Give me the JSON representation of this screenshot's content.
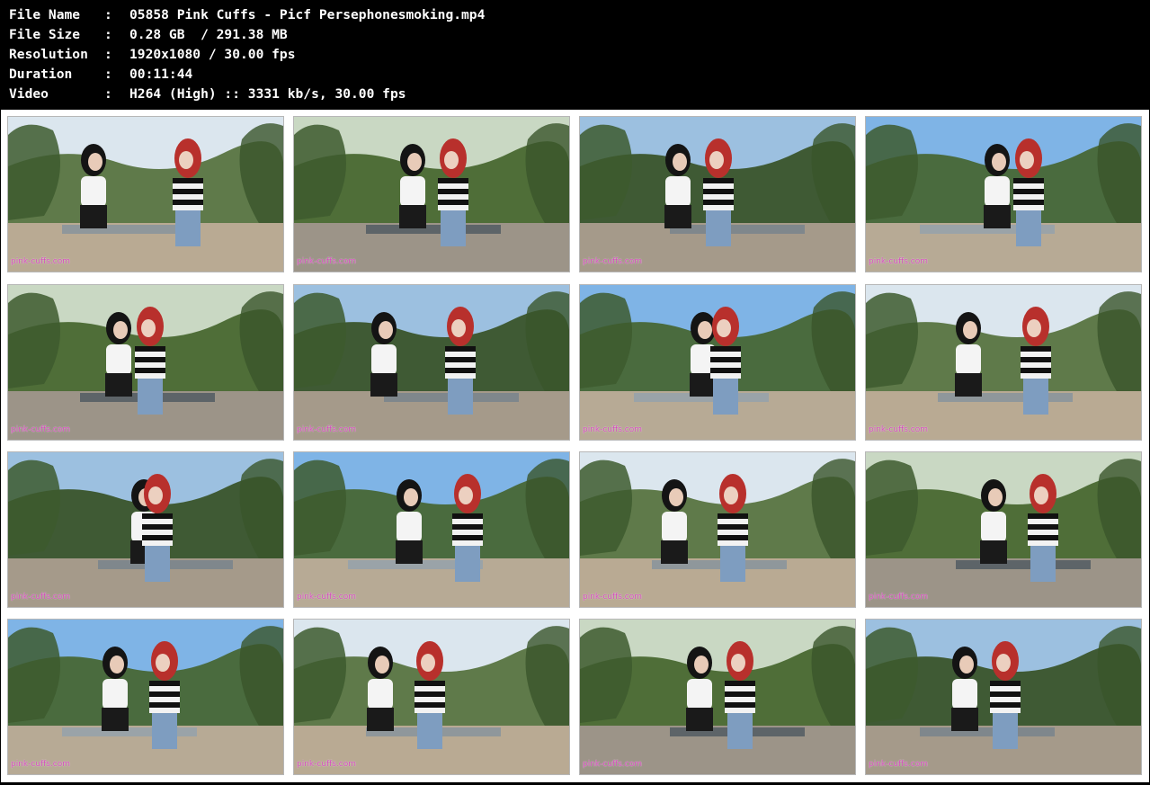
{
  "file_info": [
    {
      "key": "File Name",
      "sep": ":",
      "value": "05858 Pink Cuffs - Picf Persephonesmoking.mp4"
    },
    {
      "key": "File Size",
      "sep": ":",
      "value": "0.28 GB  / 291.38 MB"
    },
    {
      "key": "Resolution",
      "sep": ":",
      "value": "1920x1080 / 30.00 fps"
    },
    {
      "key": "Duration",
      "sep": ":",
      "value": "00:11:44"
    },
    {
      "key": "Video",
      "sep": ":",
      "value": "H264 (High) :: 3331 kb/s, 30.00 fps"
    }
  ],
  "thumbnails": {
    "count": 16,
    "columns": 4,
    "watermark": "pink-cuffs.com",
    "colors": {
      "sheet_background": "#ffffff",
      "header_background": "#000000",
      "watermark": "#d14ab8"
    }
  }
}
